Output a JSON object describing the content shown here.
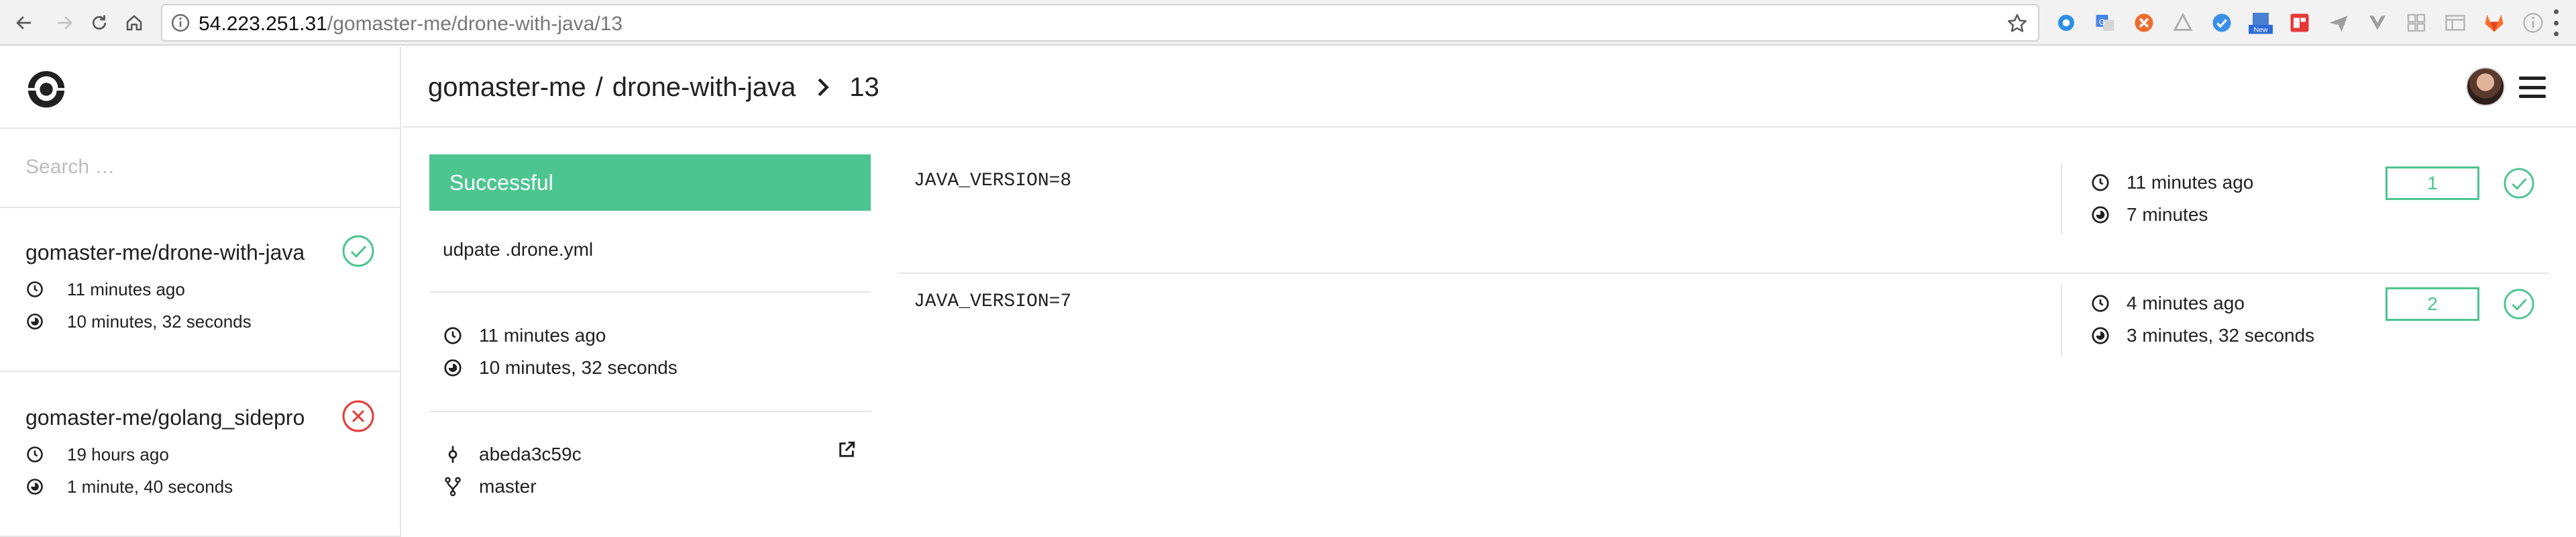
{
  "browser": {
    "url_host": "54.223.251.31",
    "url_path": "/gomaster-me/drone-with-java/13",
    "extensions": [
      "circle-icon",
      "translate-icon",
      "orange-circle-icon",
      "triangle-icon",
      "check-circle-icon",
      "new-badge-icon",
      "pdf-icon",
      "plane-icon",
      "v-icon",
      "grid-icon",
      "window-icon",
      "gitlab-icon",
      "info-circle-icon"
    ],
    "new_badge_label": "New"
  },
  "sidebar": {
    "search_placeholder": "Search …",
    "repos": [
      {
        "name": "gomaster-me/drone-with-java",
        "status": "success",
        "started": "11 minutes ago",
        "duration": "10 minutes, 32 seconds"
      },
      {
        "name": "gomaster-me/golang_sidepro",
        "status": "failure",
        "started": "19 hours ago",
        "duration": "1 minute, 40 seconds"
      }
    ]
  },
  "header": {
    "owner": "gomaster-me",
    "separator": "/",
    "repo": "drone-with-java",
    "build_number": "13"
  },
  "build": {
    "status_label": "Successful",
    "commit_message": "udpate .drone.yml",
    "started": "11 minutes ago",
    "duration": "10 minutes, 32 seconds",
    "commit_sha": "abeda3c59c",
    "branch": "master"
  },
  "matrix": [
    {
      "env": "JAVA_VERSION=8",
      "started": "11 minutes ago",
      "duration": "7 minutes",
      "number": "1",
      "status": "success"
    },
    {
      "env": "JAVA_VERSION=7",
      "started": "4 minutes ago",
      "duration": "3 minutes, 32 seconds",
      "number": "2",
      "status": "success"
    }
  ],
  "colors": {
    "success": "#4dc591",
    "failure": "#e53935",
    "text": "#212121",
    "border": "#e6e6e6"
  }
}
